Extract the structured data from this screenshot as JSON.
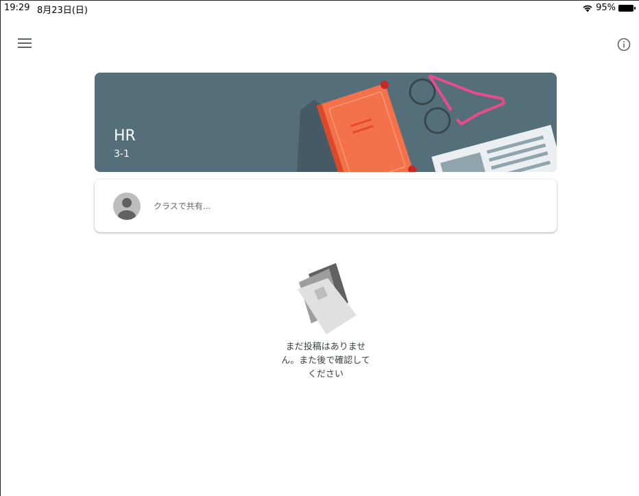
{
  "status_bar": {
    "time": "19:29",
    "date": "8月23日(日)",
    "battery": "95%",
    "wifi_icon": "wifi-icon",
    "battery_icon": "battery-icon"
  },
  "top_bar": {
    "menu_icon": "hamburger-menu-icon",
    "info_icon": "info-icon"
  },
  "banner": {
    "class_name": "HR",
    "section": "3-1",
    "background_color": "#546e7a",
    "illustration": "book-glasses-newspaper-illustration"
  },
  "share_box": {
    "placeholder": "クラスで共有..."
  },
  "empty_state": {
    "message": "まだ投稿はありませ\nん。また後で確認して\nください",
    "illustration": "empty-papers-illustration"
  }
}
